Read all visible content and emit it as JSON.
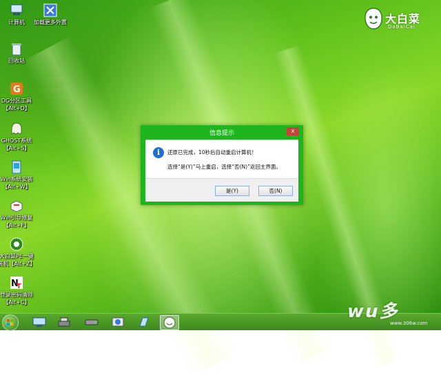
{
  "desktop_icons": [
    {
      "label": "计算机",
      "icon": "computer-icon"
    },
    {
      "label": "加载更多外置",
      "icon": "load-more-icon"
    },
    {
      "label": "回收站",
      "icon": "recycle-bin-icon"
    },
    {
      "label": "DG分区工具",
      "shortcut": "【Alt+D】",
      "icon": "diskgenius-icon"
    },
    {
      "label": "GHOST系统",
      "shortcut": "【Alt+S】",
      "icon": "ghost-icon"
    },
    {
      "label": "Win系统安装",
      "shortcut": "【Alt+W】",
      "icon": "win-install-icon"
    },
    {
      "label": "Win引导修复",
      "shortcut": "【Alt+F】",
      "icon": "boot-repair-icon"
    },
    {
      "label": "大白菜PE一键",
      "shortcut": "装机【Alt+Z】",
      "icon": "dabaicai-install-icon"
    },
    {
      "label": "登录密码清除",
      "shortcut": "【Alt+C】",
      "icon": "password-clear-icon"
    }
  ],
  "brand": {
    "name_cn": "大白菜",
    "name_en": "DaBaiCai"
  },
  "dialog": {
    "title": "信息提示",
    "close_glyph": "x",
    "message_line1": "还原已完成，10秒后自动重启计算机！",
    "message_line2": "选择“是(Y)”马上重启，选择“否(N)”返回主界面。",
    "yes_label": "是(Y)",
    "no_label": "否(N)"
  },
  "taskbar": {
    "items": [
      "start-button",
      "desktop-icon",
      "tools-icon",
      "drive-icon",
      "network-icon",
      "notepad-icon",
      "dabaicai-app-icon"
    ],
    "active_item": "dabaicai-app-icon"
  },
  "watermark": {
    "text": "wu多",
    "url": "www.306w.com"
  },
  "colors": {
    "dialog_frame": "#1fb51f",
    "wallpaper": "#62c21c",
    "info_icon": "#1f6fd0"
  }
}
